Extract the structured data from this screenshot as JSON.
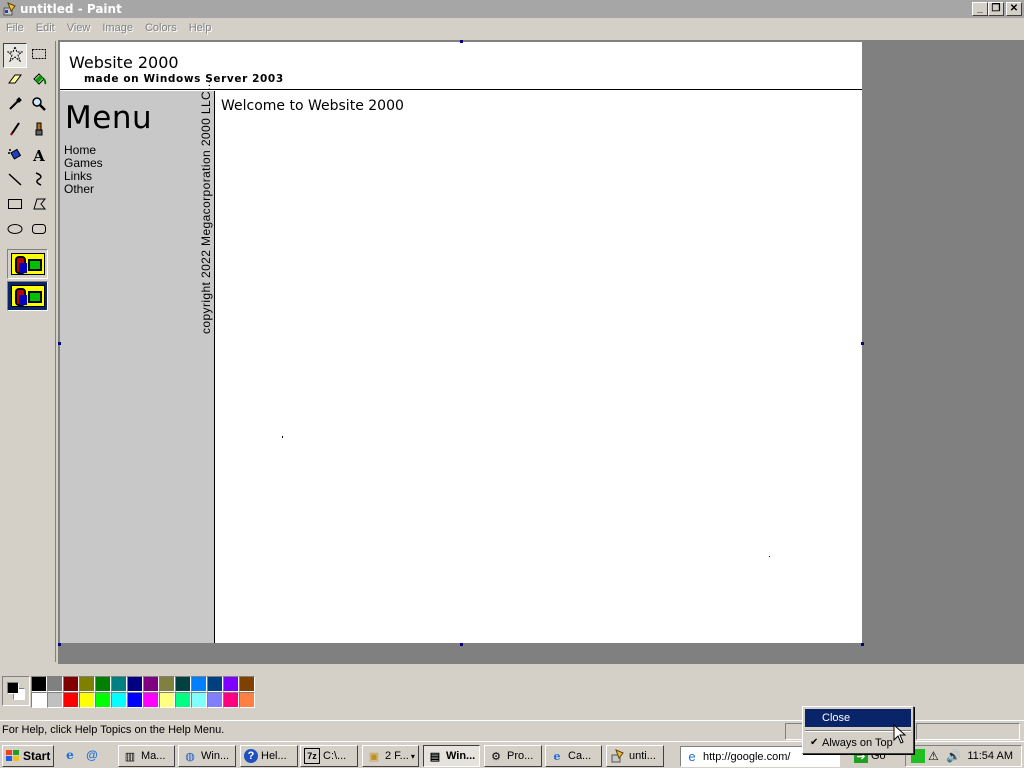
{
  "window": {
    "title": "untitled - Paint",
    "controls": [
      "minimize",
      "restore",
      "close"
    ]
  },
  "menubar": {
    "items": [
      {
        "label": "File",
        "key": "F"
      },
      {
        "label": "Edit",
        "key": "E"
      },
      {
        "label": "View",
        "key": "V"
      },
      {
        "label": "Image",
        "key": "I"
      },
      {
        "label": "Colors",
        "key": "C"
      },
      {
        "label": "Help",
        "key": "H"
      }
    ]
  },
  "toolbox": {
    "tools": [
      {
        "name": "free-form-select",
        "icon": "star-select-icon"
      },
      {
        "name": "select",
        "icon": "rect-select-icon"
      },
      {
        "name": "eraser",
        "icon": "eraser-icon"
      },
      {
        "name": "fill",
        "icon": "paint-bucket-icon"
      },
      {
        "name": "pick-color",
        "icon": "eyedropper-icon"
      },
      {
        "name": "magnifier",
        "icon": "magnifier-icon"
      },
      {
        "name": "pencil",
        "icon": "pencil-icon"
      },
      {
        "name": "brush",
        "icon": "brush-icon"
      },
      {
        "name": "airbrush",
        "icon": "airbrush-icon"
      },
      {
        "name": "text",
        "icon": "text-icon",
        "glyph": "A"
      },
      {
        "name": "line",
        "icon": "line-icon"
      },
      {
        "name": "curve",
        "icon": "curve-icon"
      },
      {
        "name": "rectangle",
        "icon": "rectangle-icon"
      },
      {
        "name": "polygon",
        "icon": "polygon-icon"
      },
      {
        "name": "ellipse",
        "icon": "ellipse-icon"
      },
      {
        "name": "rounded-rectangle",
        "icon": "rounded-rectangle-icon"
      }
    ],
    "active_tool": "free-form-select"
  },
  "canvas": {
    "site_title": "Website 2000",
    "site_subtitle": "made on Windows Server 2003",
    "menu_heading": "Menu",
    "nav": [
      "Home",
      "Games",
      "Links",
      "Other"
    ],
    "copyright": "copyright 2022 Megacorporation 2000 LLC...",
    "welcome": "Welcome to Website 2000"
  },
  "palette": {
    "foreground": "#000000",
    "background": "#ffffff",
    "colors_top": [
      "#000000",
      "#808080",
      "#800000",
      "#808000",
      "#008000",
      "#008080",
      "#000080",
      "#800080",
      "#808040",
      "#004040",
      "#0080ff",
      "#004080",
      "#8000ff",
      "#804000"
    ],
    "colors_bottom": [
      "#ffffff",
      "#c0c0c0",
      "#ff0000",
      "#ffff00",
      "#00ff00",
      "#00ffff",
      "#0000ff",
      "#ff00ff",
      "#ffff80",
      "#00ff80",
      "#80ffff",
      "#8080ff",
      "#ff0080",
      "#ff8040"
    ]
  },
  "statusbar": {
    "help_text": "For Help, click Help Topics on the Help Menu."
  },
  "context_menu": {
    "items": [
      {
        "label": "Close",
        "highlighted": true
      },
      {
        "label": "Always on Top",
        "checked": true
      }
    ]
  },
  "taskbar": {
    "start_label": "Start",
    "quick_launch": [
      "ie-icon",
      "browser-icon"
    ],
    "tasks": [
      {
        "label": "Ma...",
        "icon": "server-icon"
      },
      {
        "label": "Win...",
        "icon": "network-icon"
      },
      {
        "label": "Hel...",
        "icon": "help-icon"
      },
      {
        "label": "C:\\...",
        "icon": "7zip-icon"
      },
      {
        "label": "2 F...",
        "icon": "folder-icon"
      },
      {
        "label": "Win...",
        "icon": "window-icon",
        "active": true
      },
      {
        "label": "Pro...",
        "icon": "gear-icon"
      },
      {
        "label": "Ca...",
        "icon": "ie-icon"
      },
      {
        "label": "unti...",
        "icon": "paint-icon"
      }
    ],
    "address": "http://google.com/",
    "go_label": "Go",
    "clock": "11:54 AM"
  }
}
